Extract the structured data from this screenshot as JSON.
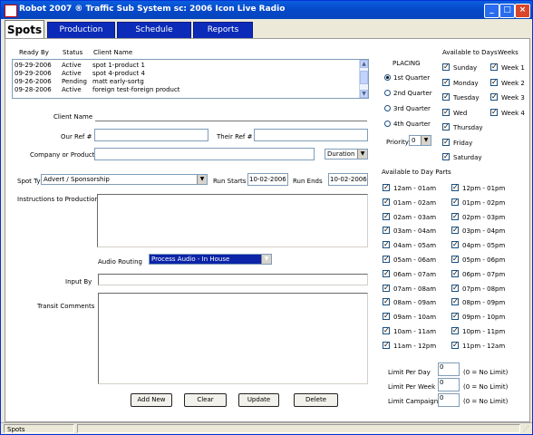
{
  "window": {
    "title": "Robot 2007 ® Traffic Sub System sc: 2006 Icon Live Radio"
  },
  "tabs": [
    {
      "label": "Spots"
    },
    {
      "label": "Production"
    },
    {
      "label": "Schedule"
    },
    {
      "label": "Reports"
    }
  ],
  "list": {
    "headers": {
      "ready_by": "Ready By",
      "status": "Status",
      "client_name": "Client Name"
    },
    "rows": [
      {
        "ready_by": "09-29-2006",
        "status": "Active",
        "client_name": "spot 1-product 1"
      },
      {
        "ready_by": "09-29-2006",
        "status": "Active",
        "client_name": "spot 4-product 4"
      },
      {
        "ready_by": "09-26-2006",
        "status": "Pending",
        "client_name": "matt early-sortg"
      },
      {
        "ready_by": "09-28-2006",
        "status": "Active",
        "client_name": "foreign test-foreign product"
      }
    ]
  },
  "form": {
    "client_name_label": "Client Name",
    "our_ref_label": "Our Ref #",
    "their_ref_label": "Their Ref #",
    "company_label": "Company or Product",
    "duration_value": "Duration",
    "spot_type_label": "Spot Type",
    "spot_type_value": "Advert / Sponsorship",
    "run_starts_label": "Run Starts",
    "run_starts_value": "10-02-2006",
    "run_ends_label": "Run Ends",
    "run_ends_value": "10-02-2006",
    "instructions_label": "Instructions to Production",
    "audio_routing_label": "Audio Routing",
    "audio_routing_value": "Process Audio - In House",
    "input_by_label": "Input By",
    "transit_comments_label": "Transit Comments"
  },
  "buttons": {
    "add_new": "Add New",
    "clear": "Clear",
    "update": "Update",
    "delete": "Delete"
  },
  "placing": {
    "title": "PLACING",
    "options": [
      {
        "label": "1st Quarter",
        "selected": true
      },
      {
        "label": "2nd Quarter",
        "selected": false
      },
      {
        "label": "3rd Quarter",
        "selected": false
      },
      {
        "label": "4th Quarter",
        "selected": false
      }
    ],
    "priority_label": "Priority",
    "priority_value": "0"
  },
  "days": {
    "title": "Available to Days",
    "items": [
      {
        "label": "Sunday",
        "checked": true
      },
      {
        "label": "Monday",
        "checked": true
      },
      {
        "label": "Tuesday",
        "checked": true
      },
      {
        "label": "Wed",
        "checked": true
      },
      {
        "label": "Thursday",
        "checked": true
      },
      {
        "label": "Friday",
        "checked": true
      },
      {
        "label": "Saturday",
        "checked": true
      }
    ]
  },
  "weeks": {
    "title": "Weeks",
    "items": [
      {
        "label": "Week 1",
        "checked": true
      },
      {
        "label": "Week 2",
        "checked": true
      },
      {
        "label": "Week 3",
        "checked": true
      },
      {
        "label": "Week 4",
        "checked": true
      }
    ]
  },
  "dayparts": {
    "title": "Available to Day Parts",
    "left": [
      {
        "label": "12am - 01am",
        "checked": true
      },
      {
        "label": "01am - 02am",
        "checked": true
      },
      {
        "label": "02am - 03am",
        "checked": true
      },
      {
        "label": "03am - 04am",
        "checked": true
      },
      {
        "label": "04am - 05am",
        "checked": true
      },
      {
        "label": "05am - 06am",
        "checked": true
      },
      {
        "label": "06am - 07am",
        "checked": true
      },
      {
        "label": "07am - 08am",
        "checked": true
      },
      {
        "label": "08am - 09am",
        "checked": true
      },
      {
        "label": "09am - 10am",
        "checked": true
      },
      {
        "label": "10am - 11am",
        "checked": true
      },
      {
        "label": "11am - 12pm",
        "checked": true
      }
    ],
    "right": [
      {
        "label": "12pm - 01pm",
        "checked": true
      },
      {
        "label": "01pm - 02pm",
        "checked": true
      },
      {
        "label": "02pm - 03pm",
        "checked": true
      },
      {
        "label": "03pm - 04pm",
        "checked": true
      },
      {
        "label": "04pm - 05pm",
        "checked": true
      },
      {
        "label": "05pm - 06pm",
        "checked": true
      },
      {
        "label": "06pm - 07pm",
        "checked": true
      },
      {
        "label": "07pm - 08pm",
        "checked": true
      },
      {
        "label": "08pm - 09pm",
        "checked": true
      },
      {
        "label": "09pm - 10pm",
        "checked": true
      },
      {
        "label": "10pm - 11pm",
        "checked": true
      },
      {
        "label": "11pm - 12am",
        "checked": true
      }
    ]
  },
  "limits": {
    "per_day_label": "Limit Per Day",
    "per_day_value": "0",
    "per_week_label": "Limit Per Week",
    "per_week_value": "0",
    "campaign_label": "Limit Campaign",
    "campaign_value": "0",
    "hint": "(0 = No Limit)"
  },
  "status_bar": {
    "text": "Spots"
  },
  "colors": {
    "title_blue": "#0648c8",
    "tab_blue": "#0b2bb8",
    "selection_blue": "#0b24a8"
  }
}
